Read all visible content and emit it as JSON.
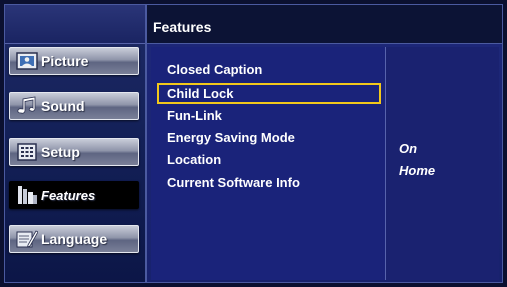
{
  "sidebar": {
    "items": [
      {
        "label": "Picture",
        "icon": "picture-icon"
      },
      {
        "label": "Sound",
        "icon": "sound-icon"
      },
      {
        "label": "Setup",
        "icon": "setup-icon"
      },
      {
        "label": "Features",
        "icon": "features-icon",
        "active": true
      },
      {
        "label": "Language",
        "icon": "language-icon"
      }
    ]
  },
  "header": {
    "title": "Features"
  },
  "features": {
    "items": [
      {
        "label": "Closed Caption",
        "value": ""
      },
      {
        "label": "Child Lock",
        "value": "",
        "selected": true
      },
      {
        "label": "Fun-Link",
        "value": ""
      },
      {
        "label": "Energy Saving Mode",
        "value": "On"
      },
      {
        "label": "Location",
        "value": "Home"
      },
      {
        "label": "Current Software Info",
        "value": ""
      }
    ]
  },
  "colors": {
    "highlight": "#f2c81b",
    "panel": "#1a237a",
    "text": "#ffffff"
  }
}
